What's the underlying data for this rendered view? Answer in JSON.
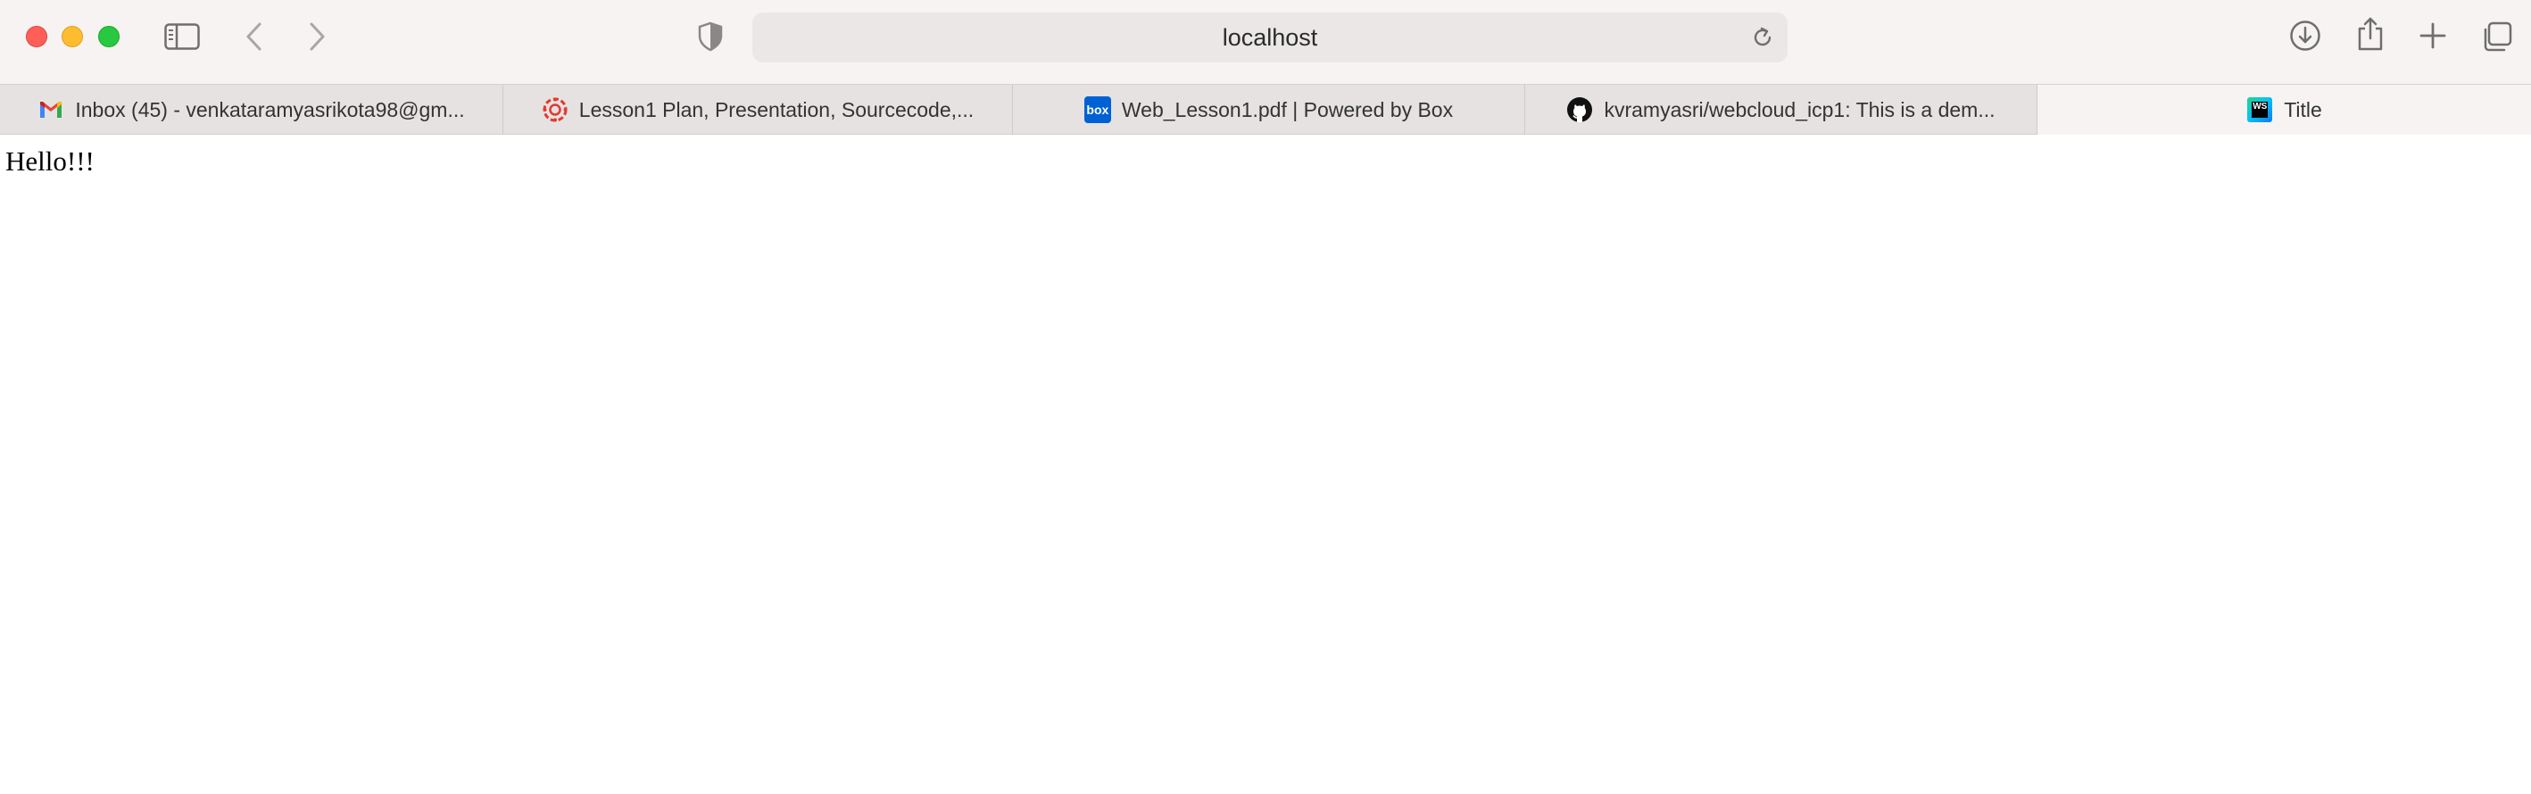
{
  "window": {
    "controls": [
      "close",
      "minimize",
      "zoom"
    ],
    "colors": {
      "close": "#ff5f57",
      "minimize": "#febc2e",
      "zoom": "#28c840"
    }
  },
  "toolbar": {
    "sidebar_icon": "sidebar-icon",
    "back_icon": "chevron-left-icon",
    "forward_icon": "chevron-right-icon",
    "privacy_icon": "shield-icon",
    "address": "localhost",
    "reload_icon": "reload-icon",
    "download_icon": "download-icon",
    "share_icon": "share-icon",
    "new_tab_icon": "plus-icon",
    "tab_overview_icon": "tab-overview-icon"
  },
  "tabs": [
    {
      "label": "Inbox (45) - venkataramyasrikota98@gm...",
      "favicon": "gmail-icon",
      "active": false
    },
    {
      "label": "Lesson1 Plan, Presentation, Sourcecode,...",
      "favicon": "canvas-icon",
      "active": false
    },
    {
      "label": "Web_Lesson1.pdf | Powered by Box",
      "favicon": "box-icon",
      "favicon_text": "box",
      "active": false
    },
    {
      "label": "kvramyasri/webcloud_icp1: This is a dem...",
      "favicon": "github-icon",
      "active": false
    },
    {
      "label": "Title",
      "favicon": "webstorm-icon",
      "favicon_text": "WS",
      "active": true
    }
  ],
  "page": {
    "text": "Hello!!!"
  }
}
